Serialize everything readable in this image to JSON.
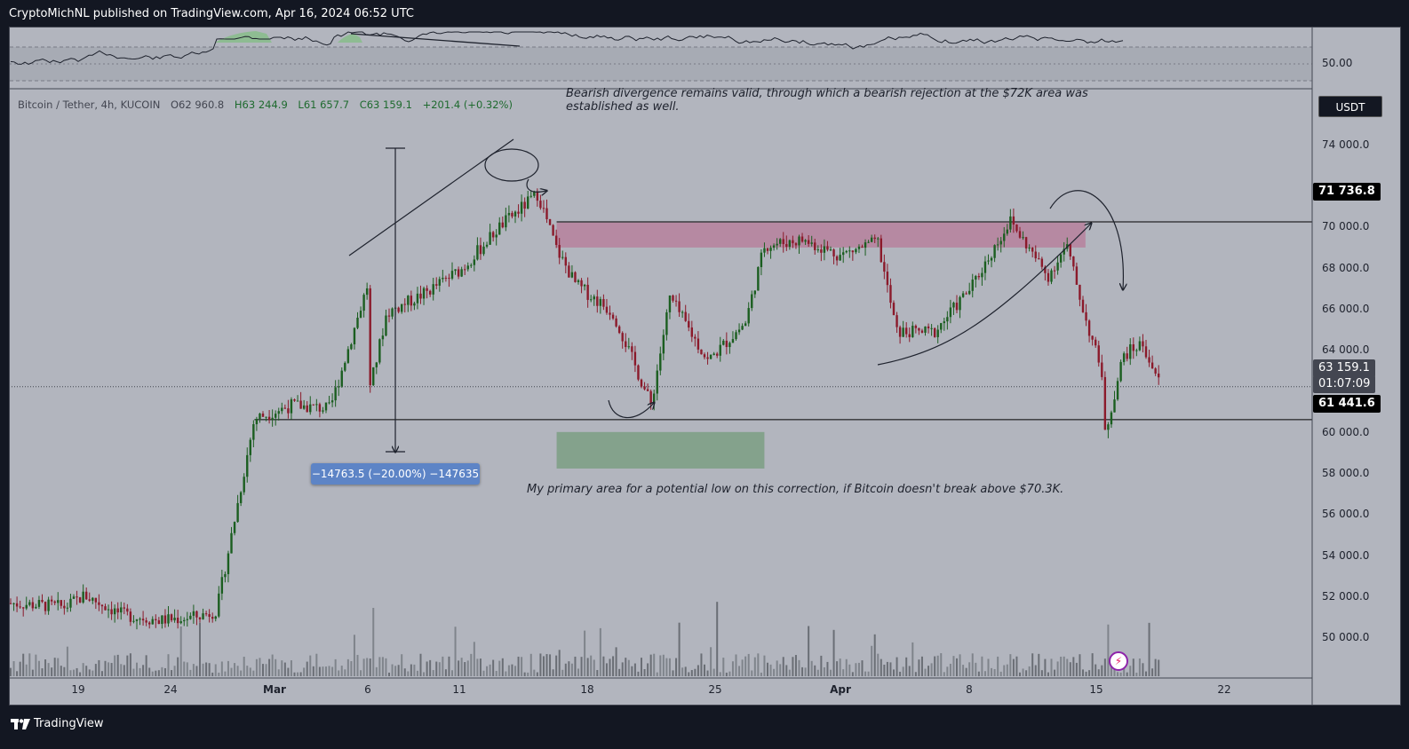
{
  "header": {
    "publisher": "CryptoMichNL published on TradingView.com, Apr 16, 2024 06:52 UTC"
  },
  "footer": {
    "brand": "TradingView"
  },
  "legend": {
    "symbol": "Bitcoin / Tether, 4h, KUCOIN",
    "open": "O62 960.8",
    "high": "H63 244.9",
    "low": "L61 657.7",
    "close": "C63 159.1",
    "change": "+201.4 (+0.32%)"
  },
  "currency": "USDT",
  "annotations": {
    "note_top": "Bearish divergence remains valid, through which a bearish rejection at the $72K area was established as well.",
    "note_bottom": "My primary area for a potential low on this correction, if Bitcoin doesn't break above $70.3K.",
    "measure": "−14763.5 (−20.00%) −147635"
  },
  "price_tags": {
    "resistance": "71 736.8",
    "last": "63 159.1",
    "countdown": "01:07:09",
    "support": "61 441.6"
  },
  "rsi_label": "50.00",
  "colors": {
    "up": "#1b5e20",
    "down": "#8b1a2b",
    "pane": "#b2b5be",
    "resist_zone": "#c2185b",
    "support_zone": "#2e7d32"
  },
  "chart_data": {
    "type": "candlestick",
    "symbol": "Bitcoin / Tether, 4h, KUCOIN",
    "x_ticks": [
      "19",
      "24",
      "Mar",
      "6",
      "11",
      "18",
      "25",
      "Apr",
      "8",
      "15",
      "22"
    ],
    "y_ticks": [
      "74 000.0",
      "70 000.0",
      "68 000.0",
      "66 000.0",
      "64 000.0",
      "60 000.0",
      "58 000.0",
      "56 000.0",
      "54 000.0",
      "52 000.0",
      "50 000.0"
    ],
    "ylim": [
      48000,
      75800
    ],
    "date_range": [
      "2024-02-15",
      "2024-04-24"
    ],
    "horizontal_levels": [
      71736.8,
      61441.6
    ],
    "last_price": 63159.1,
    "resistance_zone": [
      70400,
      71700
    ],
    "support_zone": [
      58900,
      60800
    ],
    "path": [
      [
        "2024-02-15",
        51900
      ],
      [
        "2024-02-18",
        51700
      ],
      [
        "2024-02-19",
        52300
      ],
      [
        "2024-02-21",
        51300
      ],
      [
        "2024-02-23",
        51000
      ],
      [
        "2024-02-25",
        51200
      ],
      [
        "2024-02-26",
        51500
      ],
      [
        "2024-02-27",
        56500
      ],
      [
        "2024-02-28",
        61500
      ],
      [
        "2024-03-01",
        62200
      ],
      [
        "2024-03-03",
        62000
      ],
      [
        "2024-03-05",
        68500
      ],
      [
        "2024-03-05",
        62500
      ],
      [
        "2024-03-06",
        67000
      ],
      [
        "2024-03-08",
        68000
      ],
      [
        "2024-03-10",
        69300
      ],
      [
        "2024-03-12",
        71500
      ],
      [
        "2024-03-14",
        73200
      ],
      [
        "2024-03-15",
        70300
      ],
      [
        "2024-03-16",
        68500
      ],
      [
        "2024-03-18",
        67000
      ],
      [
        "2024-03-20",
        62200
      ],
      [
        "2024-03-21",
        67800
      ],
      [
        "2024-03-23",
        64500
      ],
      [
        "2024-03-25",
        66500
      ],
      [
        "2024-03-26",
        70500
      ],
      [
        "2024-03-28",
        70800
      ],
      [
        "2024-03-30",
        70000
      ],
      [
        "2024-04-01",
        70700
      ],
      [
        "2024-04-02",
        66000
      ],
      [
        "2024-04-04",
        66000
      ],
      [
        "2024-04-06",
        68400
      ],
      [
        "2024-04-08",
        71800
      ],
      [
        "2024-04-10",
        68900
      ],
      [
        "2024-04-11",
        70500
      ],
      [
        "2024-04-12",
        66700
      ],
      [
        "2024-04-13",
        63500
      ],
      [
        "2024-04-13",
        60500
      ],
      [
        "2024-04-14",
        64800
      ],
      [
        "2024-04-15",
        65400
      ],
      [
        "2024-04-16",
        63159
      ]
    ]
  }
}
